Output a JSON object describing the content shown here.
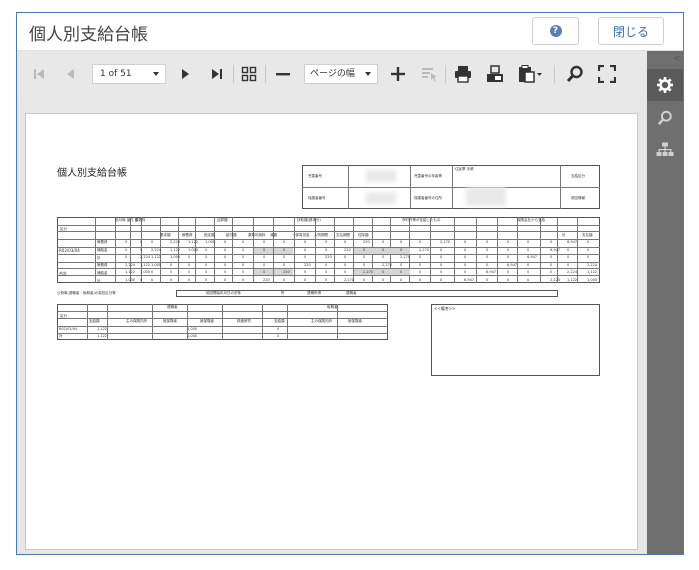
{
  "window": {
    "title": "個人別支給台帳",
    "help_icon": "help-icon",
    "close_label": "閉じる"
  },
  "toolbar": {
    "page_select_value": "1 of 51",
    "zoom_select_value": "ページの幅",
    "icons": [
      "first-page-icon",
      "prev-page-icon",
      "next-page-icon",
      "last-page-icon",
      "layout-icon",
      "zoom-out-icon",
      "zoom-in-icon",
      "select-text-icon",
      "print-icon",
      "export-icon",
      "paste-icon",
      "search-icon",
      "fullscreen-icon"
    ]
  },
  "sidebar": {
    "collapse_glyph": "<",
    "icons": [
      "gear-icon",
      "search-icon",
      "org-tree-icon"
    ]
  },
  "report": {
    "title": "個人別支給台帳",
    "info": {
      "row1": [
        "児童番号",
        "",
        "児童番号の年齢等",
        "住民票\n手帳",
        "",
        "支給区分"
      ],
      "row2": [
        "保護者番号",
        "",
        "保護者番号の住所",
        "",
        "",
        "前回情報"
      ]
    },
    "main_table": {
      "group_headers": [
        "区分",
        "前月時\n還付\n額",
        "手数料",
        "加算額",
        "扶助額(請求分)",
        "市町村等が支給したもの",
        "保険会社から支給",
        "計",
        "支払額"
      ],
      "sub_headers": [
        "基本額",
        "療養費",
        "指定額",
        "給付額",
        "薬剤利用料",
        "減額",
        "一部負担金",
        "入院期間",
        "支払期間",
        "控除額"
      ],
      "rows": [
        {
          "label": "R02/03/04",
          "kinds": [
            "療養費",
            "補給金",
            "計"
          ]
        },
        {
          "label": "合計",
          "kinds": [
            "療養費",
            "補給金",
            "計"
          ]
        }
      ],
      "values": [
        "0",
        "0",
        "0",
        "2,224",
        "1,122",
        "1,000",
        "0",
        "0",
        "0",
        "0",
        "0",
        "0",
        "0",
        "220",
        "0",
        "0",
        "0",
        "2,270",
        "0",
        "0",
        "0",
        "0",
        "0",
        "6,947"
      ]
    },
    "footer_line": {
      "left": "公費単(退職者・後期者)の負担区分等",
      "mid1": "前回開始年月日の旧条",
      "mid2": "所",
      "mid3": "退職所得",
      "right": "退職者"
    },
    "sub_table": {
      "headers": [
        "区分",
        "退職者",
        "後期者"
      ],
      "sub": [
        "支給額",
        "主の保険内訳",
        "被保険者",
        "被保険者",
        "検査研究",
        "支給額",
        "主の保険内訳",
        "被保険者"
      ],
      "rows": [
        {
          "label": "R02/03/04",
          "vals": [
            "1,122",
            "1,000",
            "0"
          ]
        },
        {
          "label": "計",
          "vals": [
            "1,122",
            "1,000",
            "0"
          ]
        }
      ]
    },
    "notes_label": "<<備考>>"
  }
}
